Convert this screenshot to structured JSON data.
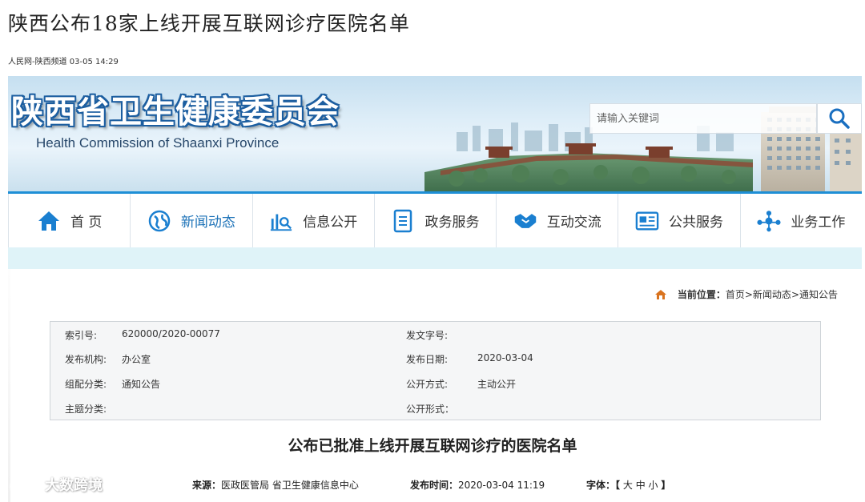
{
  "article": {
    "title": "陕西公布18家上线开展互联网诊疗医院名单",
    "byline": "人民网-陕西频道 03-05 14:29"
  },
  "banner": {
    "site_name": "陕西省卫生健康委员会",
    "site_name_en": "Health Commission of Shaanxi Province",
    "search_placeholder": "请输入关键词"
  },
  "nav": {
    "items": [
      {
        "label": "首 页",
        "icon": "home-icon"
      },
      {
        "label": "新闻动态",
        "icon": "globe-icon"
      },
      {
        "label": "信息公开",
        "icon": "chart-search-icon"
      },
      {
        "label": "政务服务",
        "icon": "document-icon"
      },
      {
        "label": "互动交流",
        "icon": "handshake-icon"
      },
      {
        "label": "公共服务",
        "icon": "newspaper-icon"
      },
      {
        "label": "业务工作",
        "icon": "network-icon"
      }
    ],
    "active_index": 1
  },
  "breadcrumb": {
    "prefix": "当前位置：",
    "items": [
      "首页",
      ">新闻动态",
      ">通知公告"
    ]
  },
  "info": {
    "index_no_label": "索引号:",
    "index_no": "620000/2020-00077",
    "doc_no_label": "发文字号:",
    "doc_no": "",
    "publisher_label": "发布机构:",
    "publisher": "办公室",
    "pub_date_label": "发布日期:",
    "pub_date": "2020-03-04",
    "category_label": "组配分类:",
    "category": "通知公告",
    "open_mode_label": "公开方式:",
    "open_mode": "主动公开",
    "topic_label": "主题分类:",
    "topic": "",
    "open_form_label": "公开形式：",
    "open_form": ""
  },
  "notice": {
    "title": "公布已批准上线开展互联网诊疗的医院名单",
    "source_label": "来源：",
    "source": "医政医管局 省卫生健康信息中心",
    "time_label": "发布时间：",
    "time": "2020-03-04 11:19",
    "font_label": "字体：",
    "font_open": "【",
    "font_large": "大",
    "font_medium": "中",
    "font_small": "小",
    "font_close": "】"
  },
  "watermark": {
    "text": "大数跨境"
  },
  "colors": {
    "nav_accent": "#1e8fd6",
    "active_nav_text": "#1e73b8",
    "icon_blue": "#1a7fd0"
  }
}
